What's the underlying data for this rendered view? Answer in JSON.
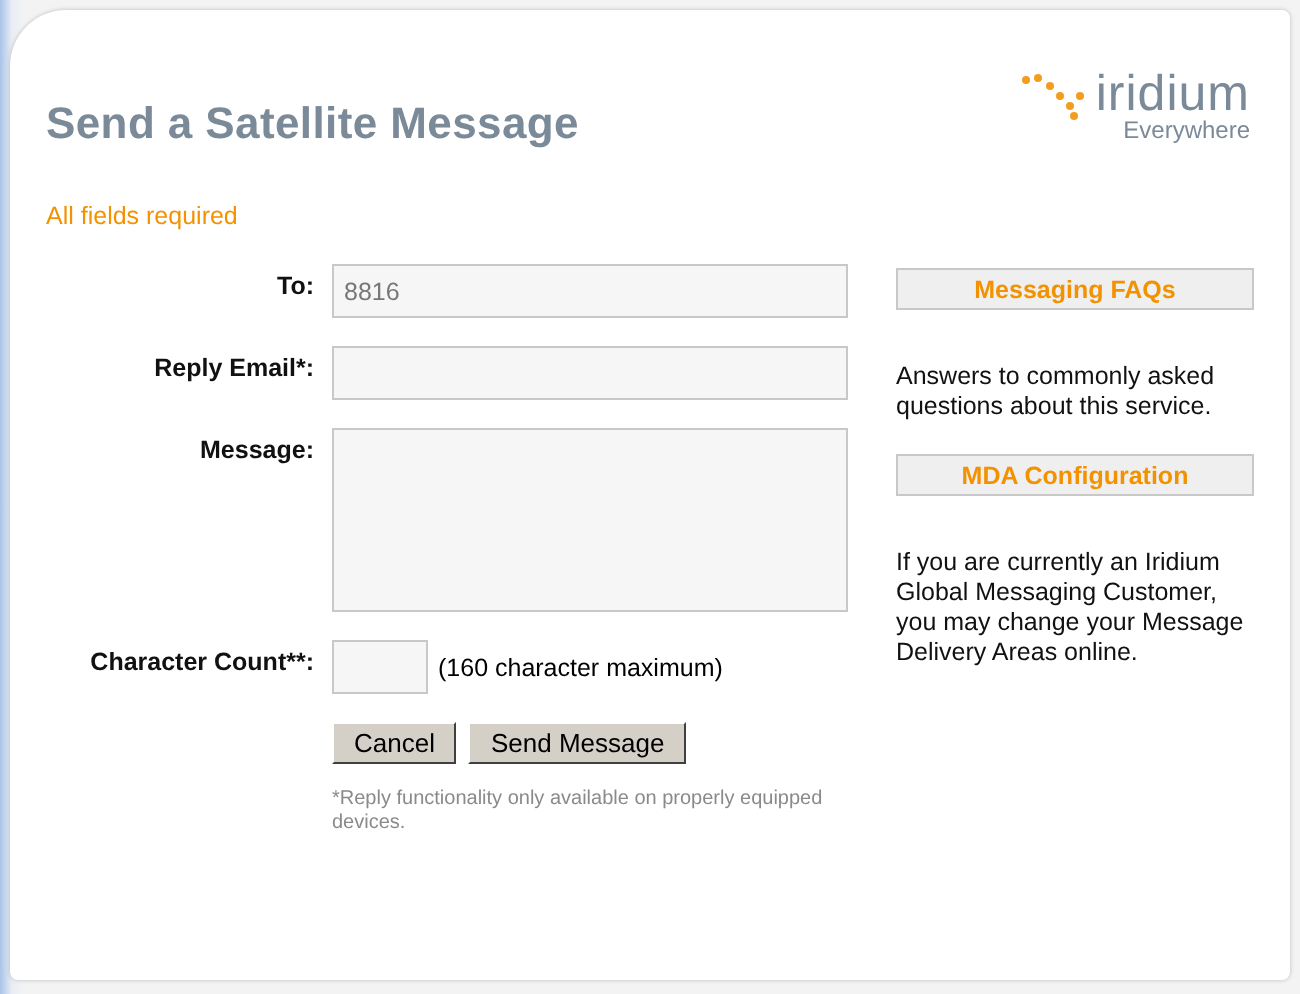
{
  "title": "Send a Satellite Message",
  "logo": {
    "name": "iridium",
    "tagline": "Everywhere"
  },
  "notice": "All fields required",
  "fields": [
    {
      "label": "To:",
      "kind": "text",
      "value": "8816"
    },
    {
      "label": "Reply Email*:",
      "kind": "text"
    },
    {
      "label": "Message:",
      "kind": "textarea"
    },
    {
      "label": "Character Count**:",
      "kind": "count",
      "hint": "(160 character maximum)"
    }
  ],
  "buttons": [
    "Cancel",
    "Send Message"
  ],
  "footnote": "*Reply functionality only available on properly equipped devices.",
  "sidebar": [
    {
      "button": "Messaging FAQs",
      "text": "Answers to commonly asked questions about this service."
    },
    {
      "button": "MDA Configuration",
      "text": "If you are currently an Iridium Global Messaging Customer, you may change your Message Delivery Areas online."
    }
  ]
}
